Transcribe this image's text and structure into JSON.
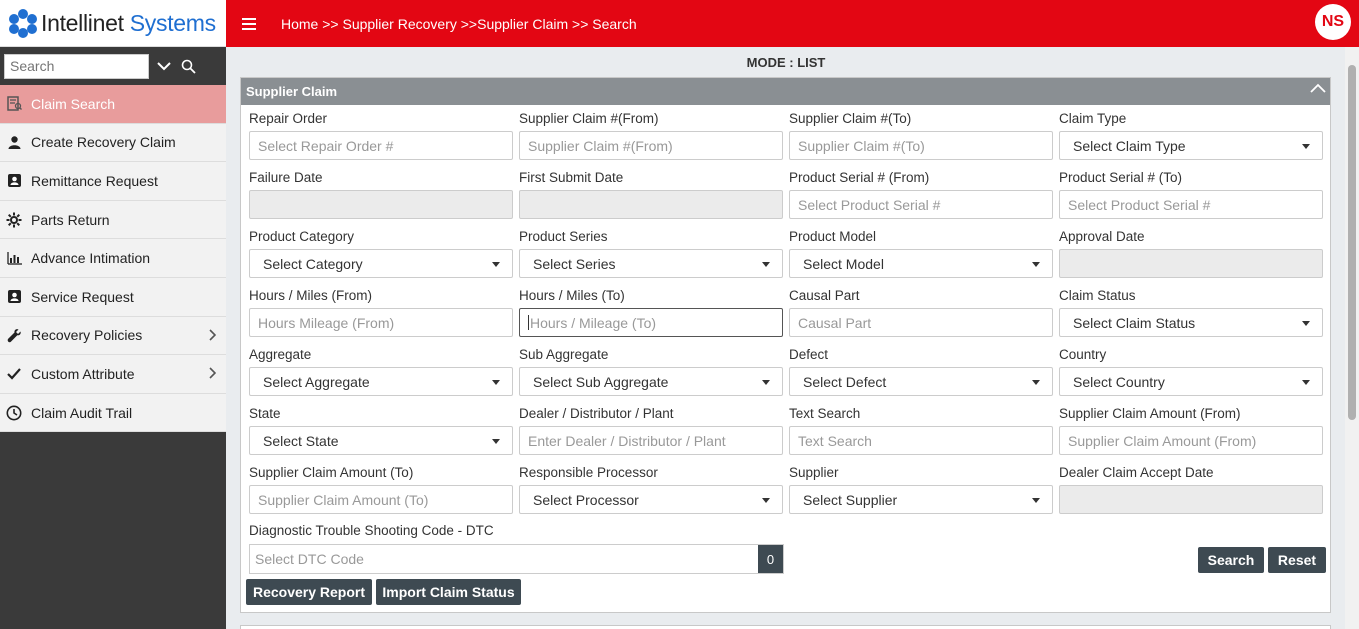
{
  "logo": {
    "brand_main": "Intellinet ",
    "brand_accent": "Systems"
  },
  "sidebar": {
    "search_placeholder": "Search",
    "items": [
      {
        "label": "Claim Search",
        "icon": "claim-search-icon",
        "active": true
      },
      {
        "label": "Create Recovery Claim",
        "icon": "user-group-icon"
      },
      {
        "label": "Remittance Request",
        "icon": "contact-card-icon"
      },
      {
        "label": "Parts Return",
        "icon": "gear-icon"
      },
      {
        "label": "Advance Intimation",
        "icon": "bar-chart-icon"
      },
      {
        "label": "Service Request",
        "icon": "contact-card-icon"
      },
      {
        "label": "Recovery Policies",
        "icon": "wrench-icon",
        "submenu": true
      },
      {
        "label": "Custom Attribute",
        "icon": "checkmark-icon",
        "submenu": true
      },
      {
        "label": "Claim Audit Trail",
        "icon": "clock-icon"
      }
    ]
  },
  "header": {
    "breadcrumb": "Home >> Supplier Recovery >>Supplier Claim >> Search",
    "avatar_initials": "NS"
  },
  "main": {
    "mode": "MODE : LIST",
    "panel_title": "Supplier Claim",
    "fields": [
      {
        "label": "Repair Order",
        "placeholder": "Select Repair Order #",
        "kind": "input"
      },
      {
        "label": "Supplier Claim #(From)",
        "placeholder": "Supplier Claim #(From)",
        "kind": "input"
      },
      {
        "label": "Supplier Claim #(To)",
        "placeholder": "Supplier Claim #(To)",
        "kind": "input"
      },
      {
        "label": "Claim Type",
        "value": "Select Claim Type",
        "kind": "select"
      },
      {
        "label": "Failure Date",
        "value": "",
        "kind": "disabled"
      },
      {
        "label": "First Submit Date",
        "value": "",
        "kind": "disabled"
      },
      {
        "label": "Product Serial # (From)",
        "placeholder": "Select Product Serial #",
        "kind": "input"
      },
      {
        "label": "Product Serial # (To)",
        "placeholder": "Select Product Serial #",
        "kind": "input"
      },
      {
        "label": "Product Category",
        "value": "Select Category",
        "kind": "select"
      },
      {
        "label": "Product Series",
        "value": "Select Series",
        "kind": "select"
      },
      {
        "label": "Product Model",
        "value": "Select Model",
        "kind": "select"
      },
      {
        "label": "Approval Date",
        "value": "",
        "kind": "disabled"
      },
      {
        "label": "Hours / Miles (From)",
        "placeholder": "Hours Mileage (From)",
        "kind": "input"
      },
      {
        "label": "Hours / Miles (To)",
        "placeholder": "Hours / Mileage (To)",
        "kind": "input",
        "focused": true
      },
      {
        "label": "Causal Part",
        "placeholder": "Causal Part",
        "kind": "input"
      },
      {
        "label": "Claim Status",
        "value": "Select Claim Status",
        "kind": "select"
      },
      {
        "label": "Aggregate",
        "value": "Select Aggregate",
        "kind": "select"
      },
      {
        "label": "Sub Aggregate",
        "value": "Select Sub Aggregate",
        "kind": "select"
      },
      {
        "label": "Defect",
        "value": "Select Defect",
        "kind": "select"
      },
      {
        "label": "Country",
        "value": "Select Country",
        "kind": "select"
      },
      {
        "label": "State",
        "value": "Select State",
        "kind": "select"
      },
      {
        "label": "Dealer / Distributor / Plant",
        "placeholder": "Enter Dealer / Distributor / Plant",
        "kind": "input"
      },
      {
        "label": "Text Search",
        "placeholder": "Text Search",
        "kind": "input"
      },
      {
        "label": "Supplier Claim Amount (From)",
        "placeholder": "Supplier Claim Amount (From)",
        "kind": "input"
      },
      {
        "label": "Supplier Claim Amount (To)",
        "placeholder": "Supplier Claim Amount (To)",
        "kind": "input"
      },
      {
        "label": "Responsible Processor",
        "value": "Select Processor",
        "kind": "select"
      },
      {
        "label": "Supplier",
        "value": "Select Supplier",
        "kind": "select"
      },
      {
        "label": "Dealer Claim Accept Date",
        "value": "",
        "kind": "disabled"
      }
    ],
    "dtc": {
      "label": "Diagnostic Trouble Shooting Code - DTC",
      "placeholder": "Select DTC Code",
      "count": "0"
    },
    "buttons": {
      "search": "Search",
      "reset": "Reset",
      "recovery_report": "Recovery Report",
      "import_claim_status": "Import Claim Status"
    }
  },
  "colors": {
    "header": "#e30613",
    "active_nav": "#e89c9c",
    "button": "#3e4a52",
    "panel_head": "#8a8f93"
  }
}
